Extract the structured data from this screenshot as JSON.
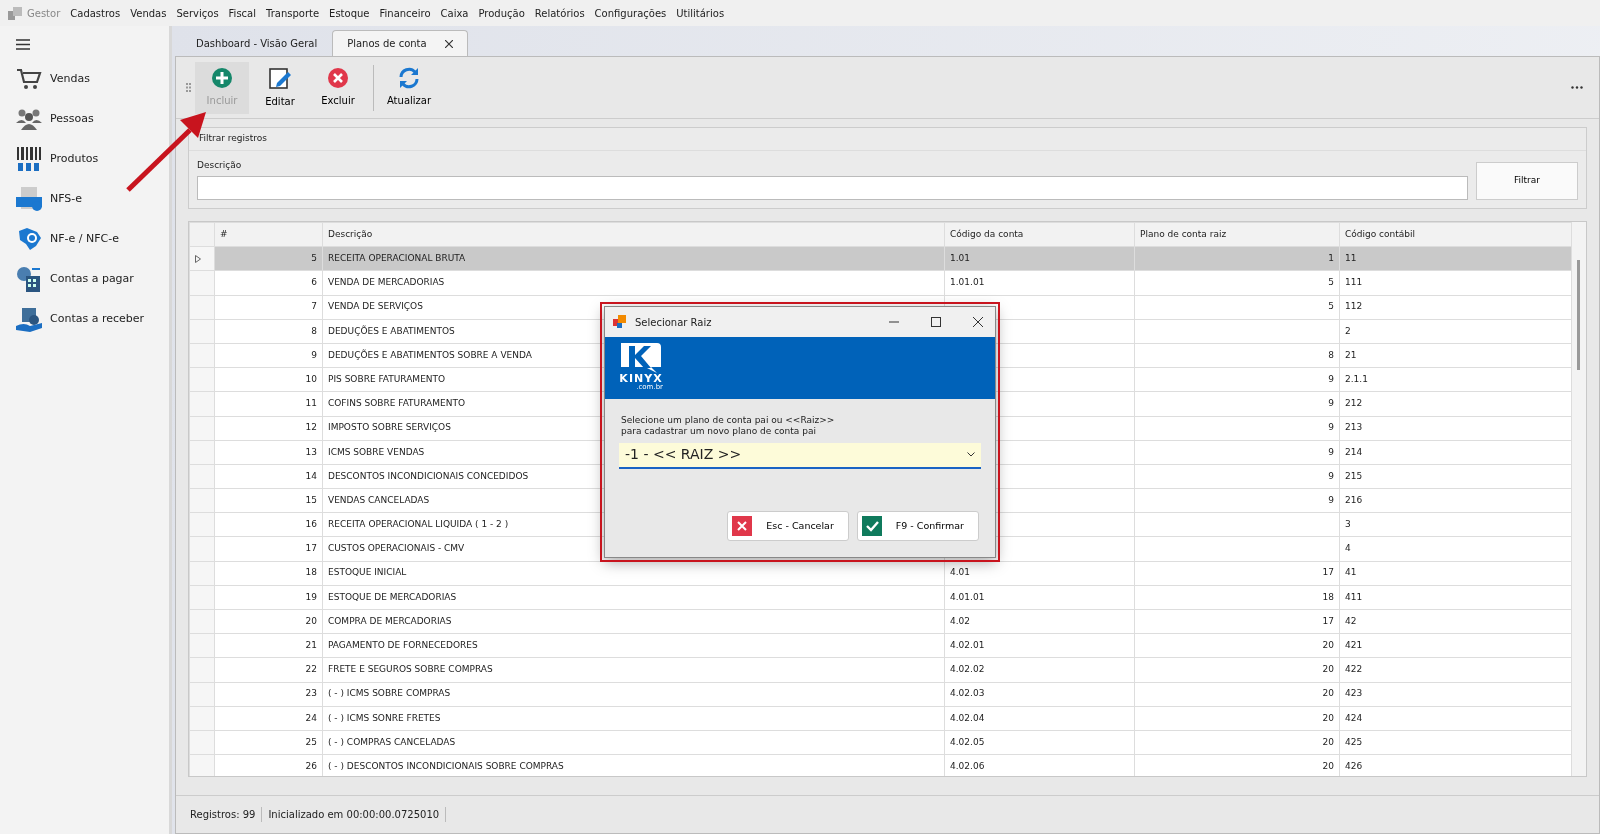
{
  "app_menu": {
    "title": "Gestor",
    "items": [
      "Cadastros",
      "Vendas",
      "Serviços",
      "Fiscal",
      "Transporte",
      "Estoque",
      "Financeiro",
      "Caixa",
      "Produção",
      "Relatórios",
      "Configurações",
      "Utilitários"
    ]
  },
  "sidebar": {
    "items": [
      {
        "label": "Vendas",
        "kind": "cart"
      },
      {
        "label": "Pessoas",
        "kind": "people"
      },
      {
        "label": "Produtos",
        "kind": "barcode"
      },
      {
        "label": "NFS-e",
        "kind": "nfse"
      },
      {
        "label": "NF-e / NFC-e",
        "kind": "nfe"
      },
      {
        "label": "Contas a pagar",
        "kind": "pay"
      },
      {
        "label": "Contas a receber",
        "kind": "receive"
      }
    ]
  },
  "tabs": [
    {
      "label": "Dashboard - Visão Geral",
      "selected": false,
      "closable": false
    },
    {
      "label": "Planos de conta",
      "selected": true,
      "closable": true
    }
  ],
  "toolbar": [
    {
      "label": "Incluir",
      "kind": "add",
      "hovered": true
    },
    {
      "label": "Editar",
      "kind": "edit",
      "hovered": false
    },
    {
      "label": "Excluir",
      "kind": "delete",
      "hovered": false
    },
    {
      "label": "Atualizar",
      "kind": "refresh",
      "hovered": false
    }
  ],
  "filter": {
    "title": "Filtrar registros",
    "field_label": "Descrição",
    "button": "Filtrar"
  },
  "table": {
    "columns": [
      "#",
      "Descrição",
      "Código da conta",
      "Plano de conta raiz",
      "Código contábil"
    ],
    "rows": [
      {
        "selected": true,
        "cells": [
          "5",
          "RECEITA OPERACIONAL BRUTA",
          "1.01",
          "1",
          "11"
        ]
      },
      {
        "selected": false,
        "cells": [
          "6",
          "VENDA DE MERCADORIAS",
          "1.01.01",
          "5",
          "111"
        ]
      },
      {
        "selected": false,
        "cells": [
          "7",
          "VENDA DE SERVIÇOS",
          "",
          "5",
          "112"
        ]
      },
      {
        "selected": false,
        "cells": [
          "8",
          "DEDUÇÕES E ABATIMENTOS",
          "",
          "",
          "2"
        ]
      },
      {
        "selected": false,
        "cells": [
          "9",
          "DEDUÇÕES E ABATIMENTOS SOBRE A VENDA",
          "",
          "8",
          "21"
        ]
      },
      {
        "selected": false,
        "cells": [
          "10",
          "PIS SOBRE FATURAMENTO",
          "",
          "9",
          "2.1.1"
        ]
      },
      {
        "selected": false,
        "cells": [
          "11",
          "COFINS SOBRE FATURAMENTO",
          "",
          "9",
          "212"
        ]
      },
      {
        "selected": false,
        "cells": [
          "12",
          "IMPOSTO SOBRE SERVIÇOS",
          "",
          "9",
          "213"
        ]
      },
      {
        "selected": false,
        "cells": [
          "13",
          "ICMS SOBRE VENDAS",
          "",
          "9",
          "214"
        ]
      },
      {
        "selected": false,
        "cells": [
          "14",
          "DESCONTOS INCONDICIONAIS CONCEDIDOS",
          "",
          "9",
          "215"
        ]
      },
      {
        "selected": false,
        "cells": [
          "15",
          "VENDAS CANCELADAS",
          "",
          "9",
          "216"
        ]
      },
      {
        "selected": false,
        "cells": [
          "16",
          "RECEITA OPERACIONAL LIQUIDA ( 1 - 2 )",
          "",
          "",
          "3"
        ]
      },
      {
        "selected": false,
        "cells": [
          "17",
          "CUSTOS OPERACIONAIS - CMV",
          "",
          "",
          "4"
        ]
      },
      {
        "selected": false,
        "cells": [
          "18",
          "ESTOQUE INICIAL",
          "4.01",
          "17",
          "41"
        ]
      },
      {
        "selected": false,
        "cells": [
          "19",
          "ESTOQUE DE MERCADORIAS",
          "4.01.01",
          "18",
          "411"
        ]
      },
      {
        "selected": false,
        "cells": [
          "20",
          "COMPRA DE MERCADORIAS",
          "4.02",
          "17",
          "42"
        ]
      },
      {
        "selected": false,
        "cells": [
          "21",
          "PAGAMENTO DE FORNECEDORES",
          "4.02.01",
          "20",
          "421"
        ]
      },
      {
        "selected": false,
        "cells": [
          "22",
          "FRETE E SEGUROS SOBRE COMPRAS",
          "4.02.02",
          "20",
          "422"
        ]
      },
      {
        "selected": false,
        "cells": [
          "23",
          "( - ) ICMS SOBRE COMPRAS",
          "4.02.03",
          "20",
          "423"
        ]
      },
      {
        "selected": false,
        "cells": [
          "24",
          "( - ) ICMS SONRE FRETES",
          "4.02.04",
          "20",
          "424"
        ]
      },
      {
        "selected": false,
        "cells": [
          "25",
          "( - ) COMPRAS CANCELADAS",
          "4.02.05",
          "20",
          "425"
        ]
      },
      {
        "selected": false,
        "cells": [
          "26",
          "( - ) DESCONTOS INCONDICIONAIS SOBRE COMPRAS",
          "4.02.06",
          "20",
          "426"
        ]
      }
    ]
  },
  "status_bar": [
    "Registros: 99",
    "Inicializado em 00:00:00.0725010"
  ],
  "dialog": {
    "title": "Selecionar Raiz",
    "logo_text": "KINYX",
    "logo_sub": ".com.br",
    "prompt": [
      "Selecione um plano de conta pai ou <<Raiz>>",
      "para cadastrar um novo plano de conta pai"
    ],
    "select_value": "-1 - << RAIZ >>",
    "buttons": [
      {
        "label": "Esc - Cancelar",
        "kind": "cancel"
      },
      {
        "label": "F9 - Confirmar",
        "kind": "confirm"
      }
    ]
  }
}
